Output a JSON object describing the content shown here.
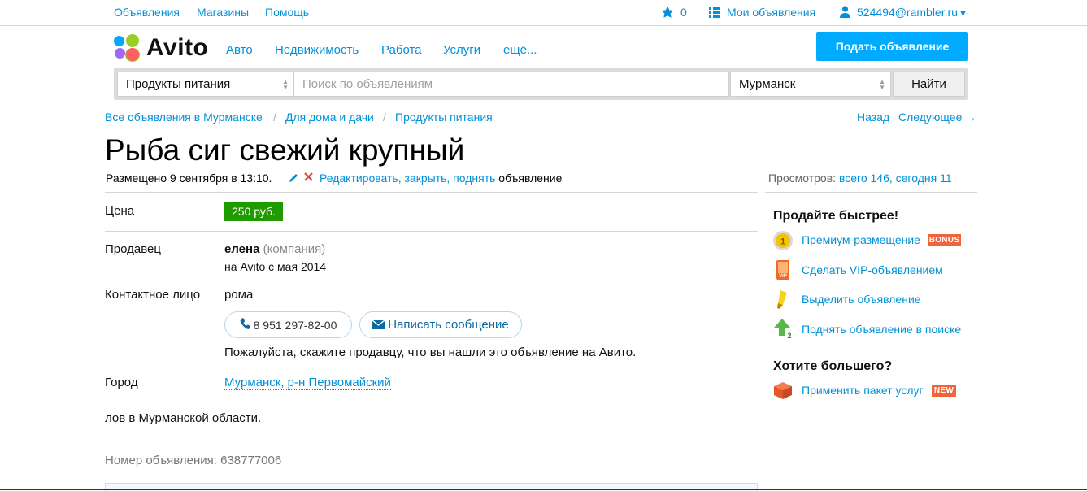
{
  "topbar": {
    "ads": "Объявления",
    "shops": "Магазины",
    "help": "Помощь",
    "favorites_count": "0",
    "my_ads": "Мои объявления",
    "user": "524494@rambler.ru"
  },
  "header": {
    "logo": "Avito",
    "nav": [
      "Авто",
      "Недвижимость",
      "Работа",
      "Услуги",
      "ещё..."
    ],
    "post_button": "Подать объявление"
  },
  "search": {
    "category": "Продукты питания",
    "placeholder": "Поиск по объявлениям",
    "city": "Мурманск",
    "find_button": "Найти"
  },
  "breadcrumbs": [
    "Все объявления в Мурманске",
    "Для дома и дачи",
    "Продукты питания"
  ],
  "breadcrumb_sep": "/",
  "paging": {
    "back": "Назад",
    "next": "Следующее →"
  },
  "ad": {
    "title": "Рыба сиг свежий крупный",
    "posted": "Размещено 9 сентября в 13:10.",
    "edit_link": "Редактировать, закрыть, поднять",
    "edit_suffix": "объявление",
    "views_label": "Просмотров:",
    "views_value": "всего 146, сегодня 11",
    "price_label": "Цена",
    "price": "250 руб.",
    "seller_label": "Продавец",
    "seller_name": "елена",
    "seller_type": "(компания)",
    "seller_since": "на Avito с мая 2014",
    "contact_label": "Контактное лицо",
    "contact_name": "рома",
    "phone": "8 951 297-82-00",
    "message_button": "Написать сообщение",
    "notice": "Пожалуйста, скажите продавцу, что вы нашли это объявление на Авито.",
    "city_label": "Город",
    "city_value": "Мурманск, р-н Первомайский",
    "description": "лов в Мурманской области.",
    "ad_number": "Номер объявления: 638777006"
  },
  "sidebar": {
    "sell_faster": "Продайте быстрее!",
    "items": [
      {
        "label": "Премиум-размещение",
        "badge": "BONUS"
      },
      {
        "label": "Сделать VIP-объявлением"
      },
      {
        "label": "Выделить объявление"
      },
      {
        "label": "Поднять объявление в поиске"
      }
    ],
    "want_more": "Хотите большего?",
    "package": {
      "label": "Применить пакет услуг",
      "badge": "NEW"
    }
  },
  "colors": {
    "link": "#0091d9",
    "post_button": "#00aaff",
    "price_bg": "#1f9b00",
    "badge": "#f0643c"
  }
}
